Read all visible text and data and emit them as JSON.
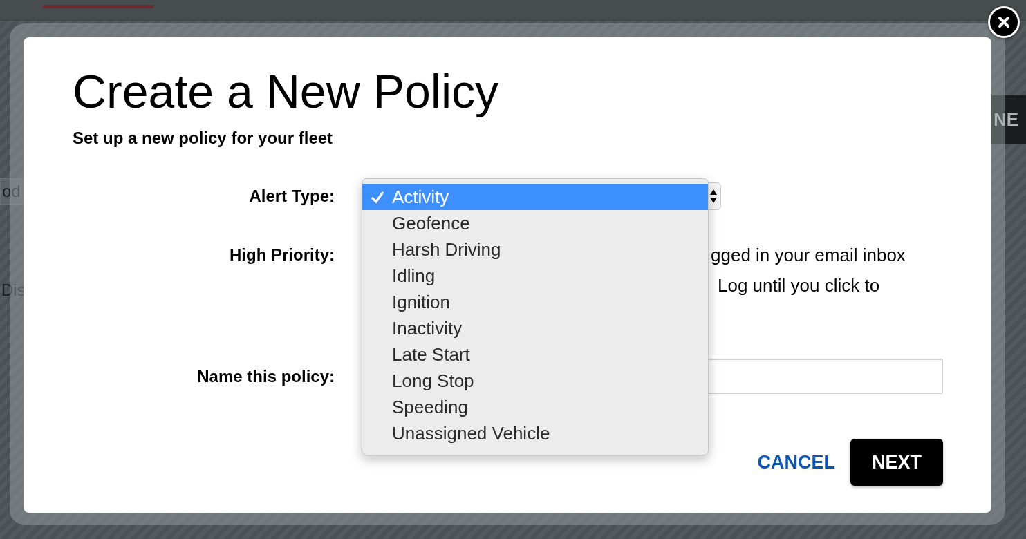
{
  "background_page": {
    "field_value": "od",
    "label": "Dis",
    "button": "NE"
  },
  "dialog": {
    "title": "Create a New Policy",
    "subtitle": "Set up a new policy for your fleet",
    "fields": [
      {
        "kind": "select",
        "label": "Alert Type:"
      },
      {
        "kind": "text",
        "label": "High Priority:",
        "lines": [
          "gged in your email inbox",
          "Log until you click to"
        ]
      },
      {
        "kind": "input",
        "label": "Name this policy:"
      }
    ],
    "dropdown": {
      "options": [
        {
          "label": "Activity",
          "selected": true
        },
        {
          "label": "Geofence",
          "selected": false
        },
        {
          "label": "Harsh Driving",
          "selected": false
        },
        {
          "label": "Idling",
          "selected": false
        },
        {
          "label": "Ignition",
          "selected": false
        },
        {
          "label": "Inactivity",
          "selected": false
        },
        {
          "label": "Late Start",
          "selected": false
        },
        {
          "label": "Long Stop",
          "selected": false
        },
        {
          "label": "Speeding",
          "selected": false
        },
        {
          "label": "Unassigned Vehicle",
          "selected": false
        }
      ]
    },
    "buttons": [
      {
        "kind": "link",
        "label": "CANCEL"
      },
      {
        "kind": "primary",
        "label": "NEXT"
      }
    ]
  }
}
